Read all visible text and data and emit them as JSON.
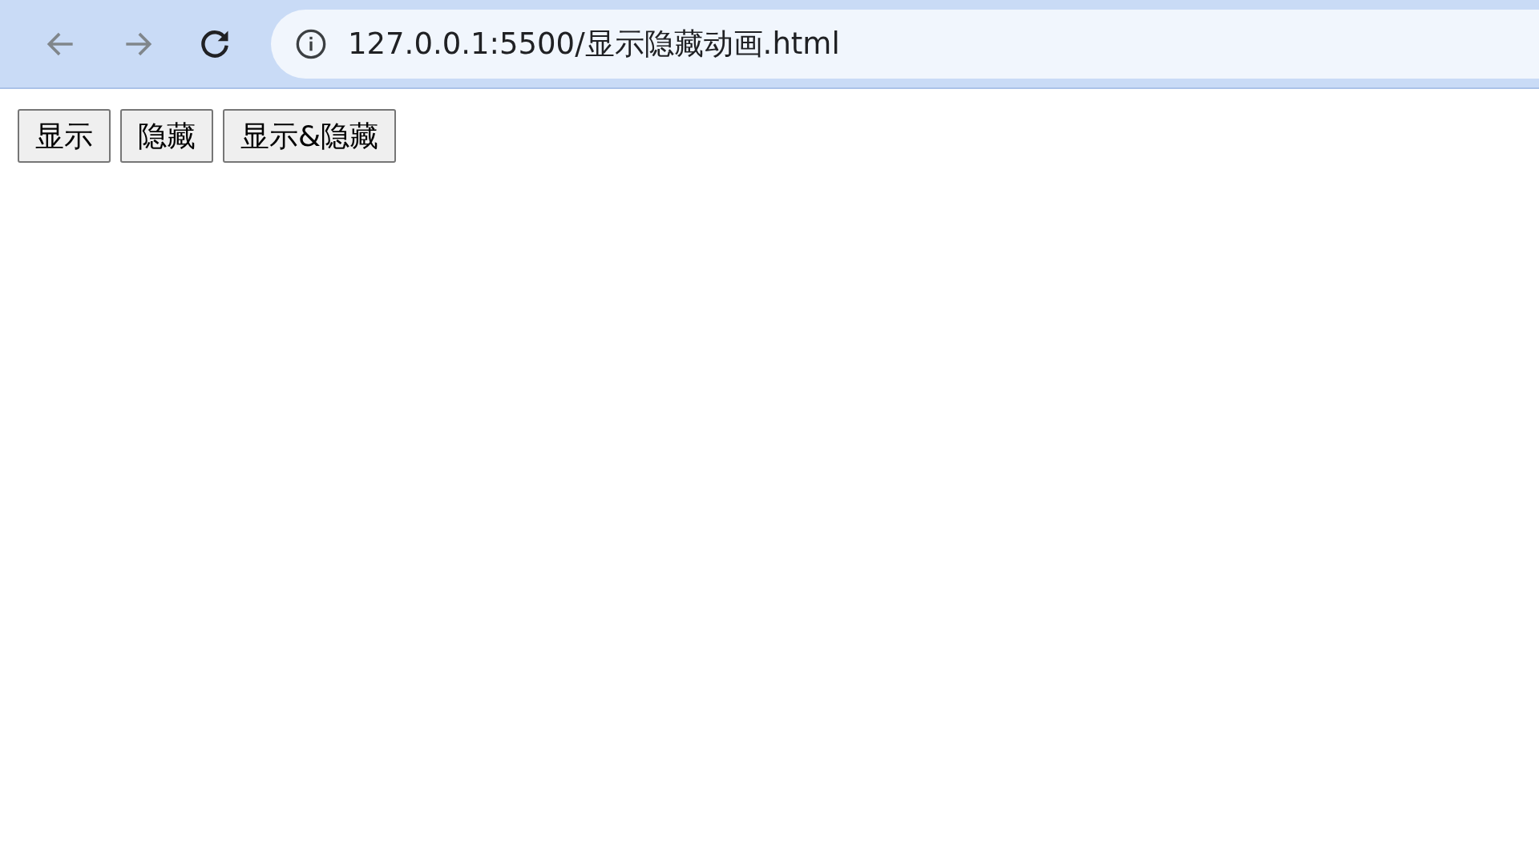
{
  "toolbar": {
    "back": {
      "disabled": true
    },
    "forward": {
      "disabled": true
    },
    "address": "127.0.0.1:5500/显示隐藏动画.html"
  },
  "buttons": [
    {
      "label": "显示"
    },
    {
      "label": "隐藏"
    },
    {
      "label": "显示&隐藏"
    }
  ]
}
